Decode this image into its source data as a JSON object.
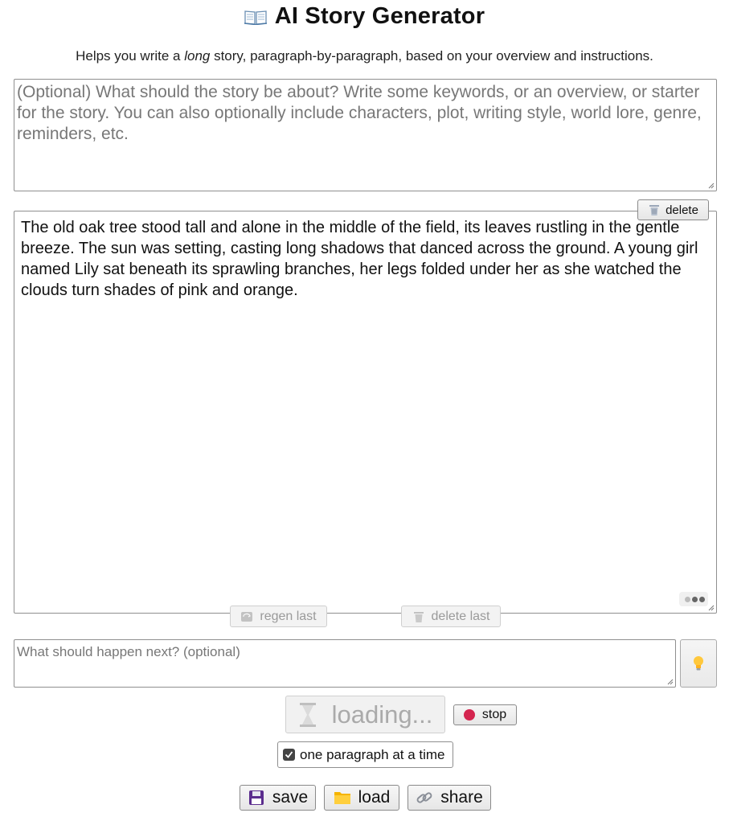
{
  "header": {
    "title": "AI Story Generator",
    "title_icon": "open-book-icon",
    "subtitle_before": "Helps you write a ",
    "subtitle_em": "long",
    "subtitle_after": " story, paragraph-by-paragraph, based on your overview and instructions."
  },
  "overview": {
    "placeholder": "(Optional) What should the story be about? Write some keywords, or an overview, or starter for the story. You can also optionally include characters, plot, writing style, world lore, genre, reminders, etc."
  },
  "story": {
    "delete_label": "delete",
    "text": "The old oak tree stood tall and alone in the middle of the field, its leaves rustling in the gentle breeze. The sun was setting, casting long shadows that danced across the ground. A young girl named Lily sat beneath its sprawling branches, her legs folded under her as she watched the clouds turn shades of pink and orange.",
    "regen_label": "regen last",
    "delete_last_label": "delete last"
  },
  "next": {
    "placeholder": "What should happen next? (optional)",
    "idea_icon": "lightbulb-icon"
  },
  "controls": {
    "loading_label": "loading...",
    "stop_label": "stop",
    "one_paragraph_label": "one paragraph at a time",
    "one_paragraph_checked": true
  },
  "footer": {
    "save_label": "save",
    "load_label": "load",
    "share_label": "share"
  },
  "colors": {
    "stop_dot": "#d4254f",
    "save_icon": "#5b2d8e",
    "load_icon": "#f5b400"
  }
}
